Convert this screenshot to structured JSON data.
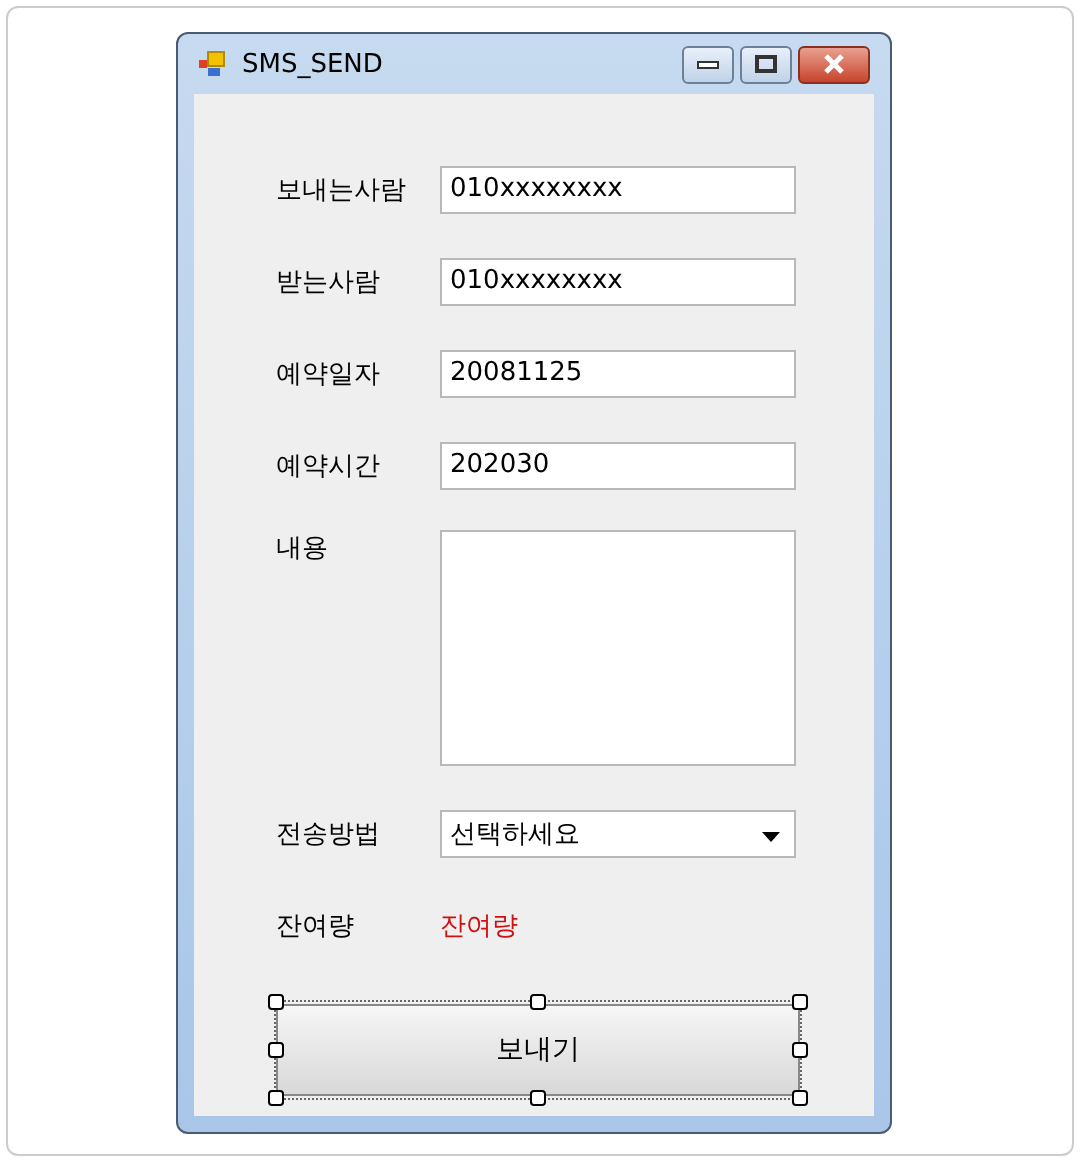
{
  "window": {
    "title": "SMS_SEND"
  },
  "fields": [
    {
      "label": "보내는사람",
      "value": "010xxxxxxxx"
    },
    {
      "label": "받는사람",
      "value": "010xxxxxxxx"
    },
    {
      "label": "예약일자",
      "value": "20081125"
    },
    {
      "label": "예약시간",
      "value": "202030"
    }
  ],
  "message": {
    "label": "내용"
  },
  "method": {
    "label": "전송방법",
    "value": "선택하세요"
  },
  "remaining": {
    "label": "잔여량",
    "value": "잔여량"
  },
  "send_button": {
    "label": "보내기",
    "selected": true
  }
}
